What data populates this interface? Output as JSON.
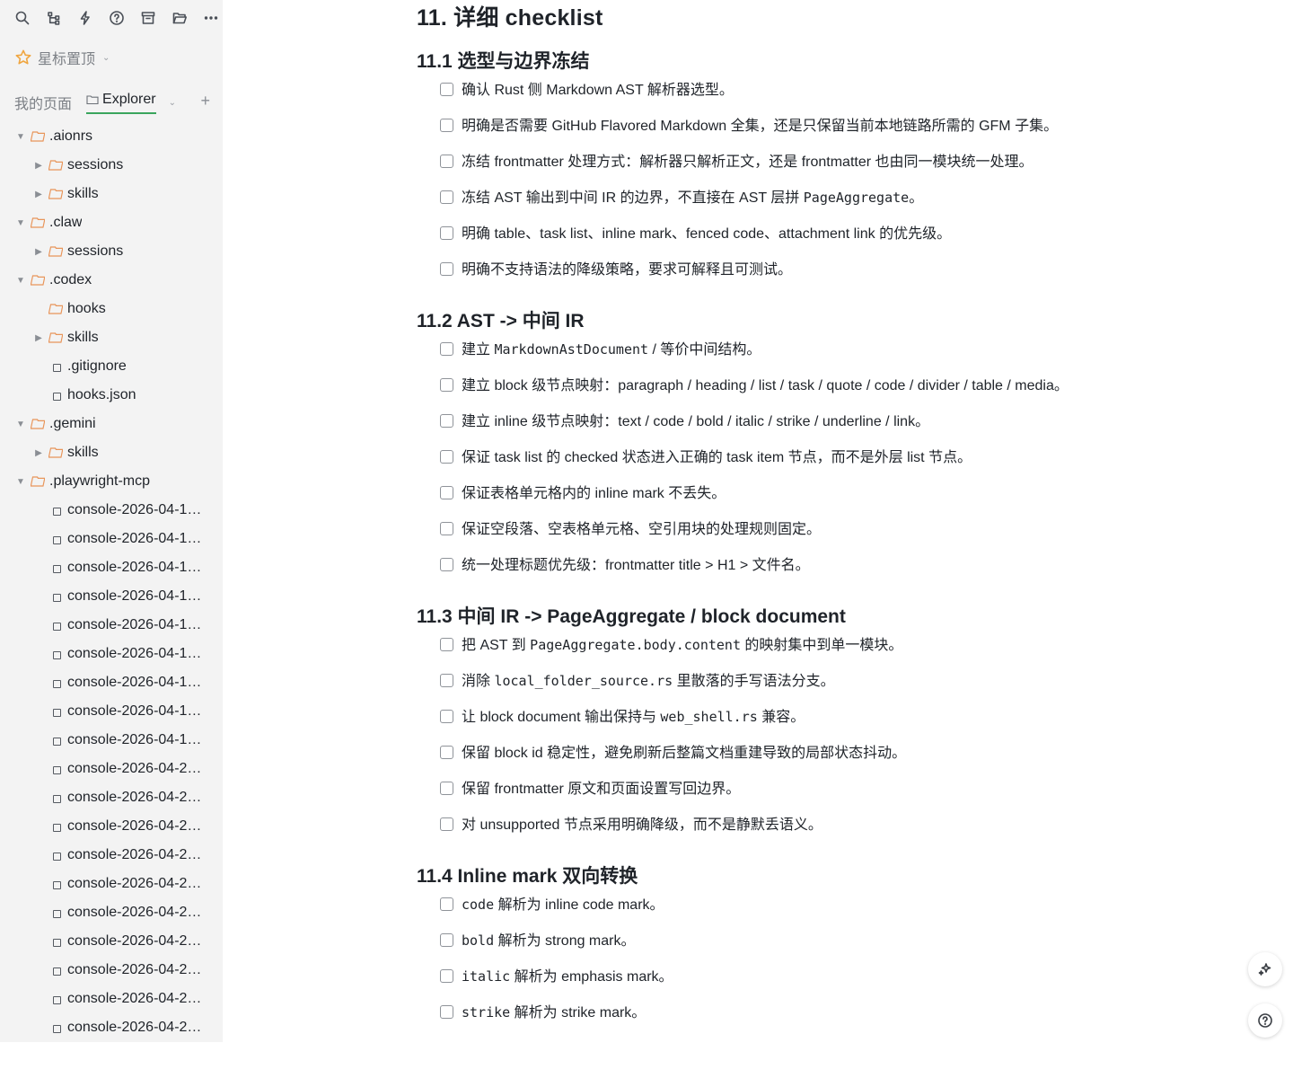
{
  "toolbar": {
    "icons": [
      "search-icon",
      "graph-icon",
      "bolt-icon",
      "help-icon",
      "archive-icon",
      "folder-open-icon",
      "more-icon"
    ]
  },
  "sidebar": {
    "starred_label": "星标置顶",
    "tab_my_pages": "我的页面",
    "tab_explorer": "Explorer",
    "accent_color": "#3aa55d",
    "folder_color": "#e8955a"
  },
  "tree": [
    {
      "label": ".aionrs",
      "type": "folder",
      "level": 0,
      "expanded": true
    },
    {
      "label": "sessions",
      "type": "folder",
      "level": 1,
      "expanded": false
    },
    {
      "label": "skills",
      "type": "folder",
      "level": 1,
      "expanded": false
    },
    {
      "label": ".claw",
      "type": "folder",
      "level": 0,
      "expanded": true
    },
    {
      "label": "sessions",
      "type": "folder",
      "level": 1,
      "expanded": false
    },
    {
      "label": ".codex",
      "type": "folder",
      "level": 0,
      "expanded": true
    },
    {
      "label": "hooks",
      "type": "folder",
      "level": 1,
      "expanded": null
    },
    {
      "label": "skills",
      "type": "folder",
      "level": 1,
      "expanded": false
    },
    {
      "label": ".gitignore",
      "type": "file",
      "level": 1
    },
    {
      "label": "hooks.json",
      "type": "file",
      "level": 1
    },
    {
      "label": ".gemini",
      "type": "folder",
      "level": 0,
      "expanded": true
    },
    {
      "label": "skills",
      "type": "folder",
      "level": 1,
      "expanded": false
    },
    {
      "label": ".playwright-mcp",
      "type": "folder",
      "level": 0,
      "expanded": true
    },
    {
      "label": "console-2026-04-1…",
      "type": "file",
      "level": 1
    },
    {
      "label": "console-2026-04-1…",
      "type": "file",
      "level": 1
    },
    {
      "label": "console-2026-04-1…",
      "type": "file",
      "level": 1
    },
    {
      "label": "console-2026-04-1…",
      "type": "file",
      "level": 1
    },
    {
      "label": "console-2026-04-1…",
      "type": "file",
      "level": 1
    },
    {
      "label": "console-2026-04-1…",
      "type": "file",
      "level": 1
    },
    {
      "label": "console-2026-04-1…",
      "type": "file",
      "level": 1
    },
    {
      "label": "console-2026-04-1…",
      "type": "file",
      "level": 1
    },
    {
      "label": "console-2026-04-1…",
      "type": "file",
      "level": 1
    },
    {
      "label": "console-2026-04-2…",
      "type": "file",
      "level": 1
    },
    {
      "label": "console-2026-04-2…",
      "type": "file",
      "level": 1
    },
    {
      "label": "console-2026-04-2…",
      "type": "file",
      "level": 1
    },
    {
      "label": "console-2026-04-2…",
      "type": "file",
      "level": 1
    },
    {
      "label": "console-2026-04-2…",
      "type": "file",
      "level": 1
    },
    {
      "label": "console-2026-04-2…",
      "type": "file",
      "level": 1
    },
    {
      "label": "console-2026-04-2…",
      "type": "file",
      "level": 1
    },
    {
      "label": "console-2026-04-2…",
      "type": "file",
      "level": 1
    },
    {
      "label": "console-2026-04-2…",
      "type": "file",
      "level": 1
    },
    {
      "label": "console-2026-04-2…",
      "type": "file",
      "level": 1
    }
  ],
  "doc": {
    "title": "11. 详细 checklist",
    "sections": [
      {
        "heading": "11.1 选型与边界冻结",
        "tasks": [
          {
            "parts": [
              {
                "t": "确认 Rust 侧 Markdown AST 解析器选型。"
              }
            ]
          },
          {
            "parts": [
              {
                "t": "明确是否需要 GitHub Flavored Markdown 全集，还是只保留当前本地链路所需的 GFM 子集。"
              }
            ]
          },
          {
            "parts": [
              {
                "t": "冻结 frontmatter 处理方式：解析器只解析正文，还是 frontmatter 也由同一模块统一处理。"
              }
            ]
          },
          {
            "parts": [
              {
                "t": "冻结 AST 输出到中间 IR 的边界，不直接在 AST 层拼 "
              },
              {
                "t": "PageAggregate",
                "code": true
              },
              {
                "t": "。"
              }
            ]
          },
          {
            "parts": [
              {
                "t": "明确 table、task list、inline mark、fenced code、attachment link 的优先级。"
              }
            ]
          },
          {
            "parts": [
              {
                "t": "明确不支持语法的降级策略，要求可解释且可测试。"
              }
            ]
          }
        ]
      },
      {
        "heading": "11.2 AST -> 中间 IR",
        "tasks": [
          {
            "parts": [
              {
                "t": "建立 "
              },
              {
                "t": "MarkdownAstDocument",
                "code": true
              },
              {
                "t": " / 等价中间结构。"
              }
            ]
          },
          {
            "parts": [
              {
                "t": "建立 block 级节点映射：paragraph / heading / list / task / quote / code / divider / table / media。"
              }
            ]
          },
          {
            "parts": [
              {
                "t": "建立 inline 级节点映射：text / code / bold / italic / strike / underline / link。"
              }
            ]
          },
          {
            "parts": [
              {
                "t": "保证 task list 的 checked 状态进入正确的 task item 节点，而不是外层 list 节点。"
              }
            ]
          },
          {
            "parts": [
              {
                "t": "保证表格单元格内的 inline mark 不丢失。"
              }
            ]
          },
          {
            "parts": [
              {
                "t": "保证空段落、空表格单元格、空引用块的处理规则固定。"
              }
            ]
          },
          {
            "parts": [
              {
                "t": "统一处理标题优先级：frontmatter title > H1 > 文件名。"
              }
            ]
          }
        ]
      },
      {
        "heading": "11.3 中间 IR -> PageAggregate / block document",
        "tasks": [
          {
            "parts": [
              {
                "t": "把 AST 到 "
              },
              {
                "t": "PageAggregate.body.content",
                "code": true
              },
              {
                "t": " 的映射集中到单一模块。"
              }
            ]
          },
          {
            "parts": [
              {
                "t": "消除 "
              },
              {
                "t": "local_folder_source.rs",
                "code": true
              },
              {
                "t": " 里散落的手写语法分支。"
              }
            ]
          },
          {
            "parts": [
              {
                "t": "让 block document 输出保持与 "
              },
              {
                "t": "web_shell.rs",
                "code": true
              },
              {
                "t": " 兼容。"
              }
            ]
          },
          {
            "parts": [
              {
                "t": "保留 block id 稳定性，避免刷新后整篇文档重建导致的局部状态抖动。"
              }
            ]
          },
          {
            "parts": [
              {
                "t": "保留 frontmatter 原文和页面设置写回边界。"
              }
            ]
          },
          {
            "parts": [
              {
                "t": "对 unsupported 节点采用明确降级，而不是静默丢语义。"
              }
            ]
          }
        ]
      },
      {
        "heading": "11.4 Inline mark 双向转换",
        "tasks": [
          {
            "parts": [
              {
                "t": "code",
                "code": true
              },
              {
                "t": " 解析为 inline code mark。"
              }
            ]
          },
          {
            "parts": [
              {
                "t": "bold",
                "code": true
              },
              {
                "t": " 解析为 strong mark。"
              }
            ]
          },
          {
            "parts": [
              {
                "t": "italic",
                "code": true
              },
              {
                "t": " 解析为 emphasis mark。"
              }
            ]
          },
          {
            "parts": [
              {
                "t": "strike",
                "code": true
              },
              {
                "t": " 解析为 strike mark。"
              }
            ]
          }
        ]
      }
    ]
  },
  "fab": {
    "icons": [
      "sparkle-icon",
      "help-icon"
    ]
  }
}
